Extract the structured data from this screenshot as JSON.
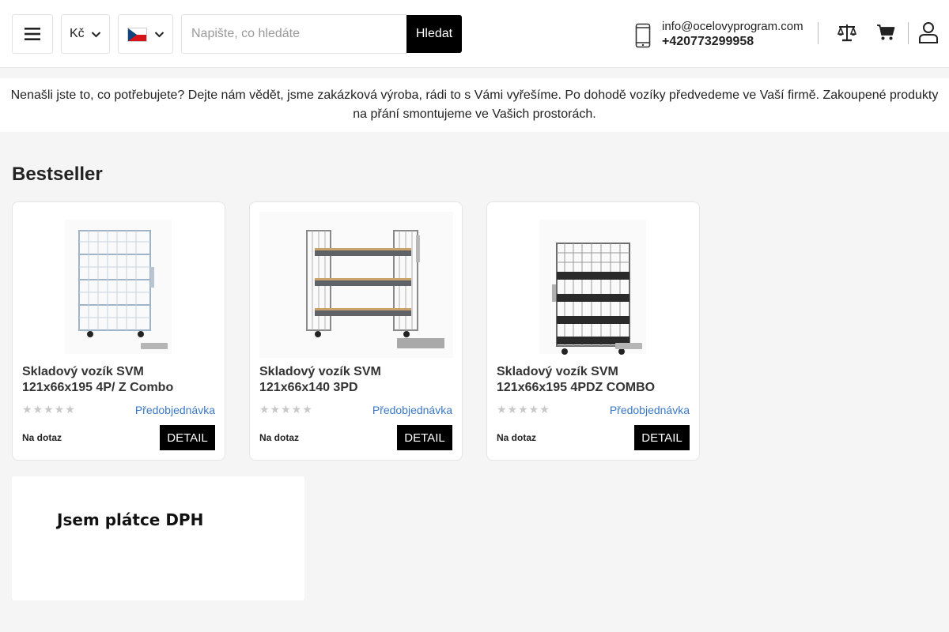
{
  "header": {
    "currency": "Kč",
    "language_flag": "czech-flag",
    "search": {
      "placeholder": "Napište, co hledáte",
      "button_label": "Hledat"
    },
    "contact": {
      "email": "info@ocelovyprogram.com",
      "phone": "+420773299958"
    },
    "icons": [
      "menu-icon",
      "chevron-down-icon",
      "phone-icon",
      "compare-scales-icon",
      "cart-icon",
      "user-icon"
    ]
  },
  "notice": {
    "text": "Nenašli jste to, co potřebujete? Dejte nám vědět, jsme zakázková výroba, rádi to s Vámi vyřešíme. Po dohodě vozíky předvedeme ve Vaší firmě. Zakoupené produkty na přání smontujeme ve Vašich prostorách."
  },
  "bestseller": {
    "title": "Bestseller",
    "products": [
      {
        "name": "Skladový vozík SVM 121x66x195 4P/ Z Combo",
        "rating": 0,
        "availability": "Předobjednávka",
        "price": "Na dotaz",
        "button_label": "DETAIL"
      },
      {
        "name": "Skladový vozík SVM 121x66x140 3PD",
        "rating": 0,
        "availability": "Předobjednávka",
        "price": "Na dotaz",
        "button_label": "DETAIL"
      },
      {
        "name": "Skladový vozík SVM 121x66x195 4PDZ COMBO",
        "rating": 0,
        "availability": "Předobjednávka",
        "price": "Na dotaz",
        "button_label": "DETAIL"
      }
    ]
  },
  "vat_banner": {
    "text": "Jsem plátce DPH"
  },
  "colors": {
    "accent_button": "#000000",
    "availability_link": "#3a78c4",
    "star_empty": "#c8c8c8"
  }
}
